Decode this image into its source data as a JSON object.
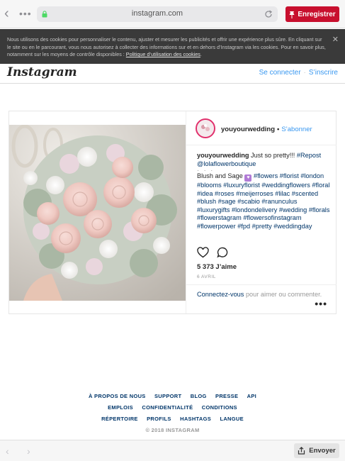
{
  "browser": {
    "url": "instagram.com",
    "save_label": "Enregistrer"
  },
  "cookie_banner": {
    "text": "Nous utilisons des cookies pour personnaliser le contenu, ajuster et mesurer les publicités et offrir une expérience plus sûre. En cliquant sur le site ou en le parcourant, vous nous autorisez à collecter des informations sur et en dehors d’Instagram via les cookies. Pour en savoir plus, notamment sur les moyens de contrôle disponibles : ",
    "link": "Politique d’utilisation des cookies",
    "close": "✕"
  },
  "header": {
    "logo": "Instagram",
    "login": "Se connecter",
    "separator": "·",
    "signup": "S’inscrire"
  },
  "post": {
    "username": "youyourwedding",
    "dot": "•",
    "follow": "S’abonner",
    "caption_user": "youyourwedding",
    "caption_line1": " Just so pretty!!! ",
    "repost_tag": "#Repost",
    "mention": "@lolaflowerboutique",
    "dots": "· · ·",
    "blush_text": "Blush and Sage ",
    "hashtags": "#flowers #florist #london #blooms #luxuryflorist #weddingflowers #floral #idea #roses #meijerroses #lilac #scented #blush #sage #scabio #ranunculus #luxurygifts #londondelivery #wedding #florals #flowerstagram #flowersofinstagram #flowerpower #fpd #pretty #weddingday",
    "likes_count": "5 373",
    "likes_label": " J’aime",
    "date": "6 AVRIL",
    "comment_link": "Connectez-vous",
    "comment_text": " pour aimer ou commenter.",
    "more": "•••"
  },
  "footer": {
    "row1": [
      "À PROPOS DE NOUS",
      "SUPPORT",
      "BLOG",
      "PRESSE",
      "API"
    ],
    "row2": [
      "EMPLOIS",
      "CONFIDENTIALITÉ",
      "CONDITIONS"
    ],
    "row3": [
      "RÉPERTOIRE",
      "PROFILS",
      "HASHTAGS",
      "LANGUE"
    ],
    "copyright": "© 2018 INSTAGRAM"
  },
  "bottom_bar": {
    "send_label": "Envoyer"
  },
  "colors": {
    "accent_blue": "#3897f0",
    "link_navy": "#003569",
    "pinterest_red": "#c8102e"
  }
}
